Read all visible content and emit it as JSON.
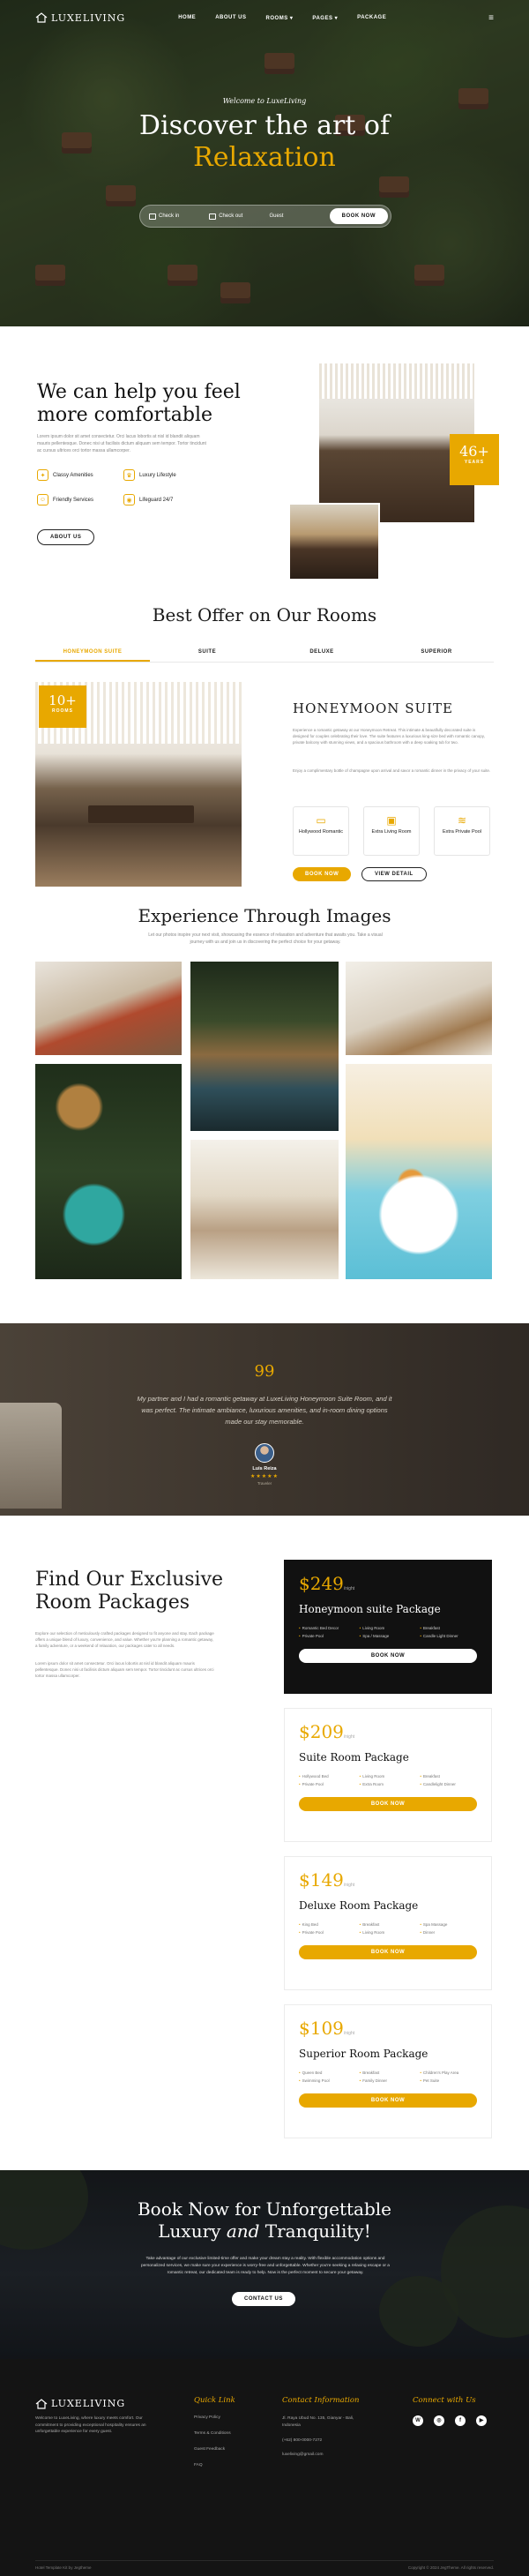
{
  "brand": {
    "name": "LUXELIVING"
  },
  "nav": {
    "items": [
      "HOME",
      "ABOUT US",
      "ROOMS",
      "PAGES",
      "PACKAGE"
    ]
  },
  "hero": {
    "subtitle": "Welcome to LuxeLiving",
    "title_line1": "Discover the art of",
    "title_line2": "Relaxation",
    "checkin": "Check in",
    "checkout": "Check out",
    "guest": "Guest",
    "book_button": "BOOK NOW"
  },
  "about": {
    "title_line1": "We can help you feel",
    "title_line2": "more comfortable",
    "text": "Lorem ipsum dolor sit amet consectetur. Orci lacus lobortis at nisl id blandit aliquam mauris pellentesque. Donec nisi ut facilisis dictum aliquam sem tempor. Tortor tincidunt ac cursus ultrices orci tortor massa ullamcorper.",
    "amenities": [
      "Classy Amenities",
      "Luxury Lifestyle",
      "Friendly Services",
      "Lifeguard 24/7"
    ],
    "button": "ABOUT US",
    "years_number": "46+",
    "years_label": "YEARS"
  },
  "rooms": {
    "title": "Best Offer on Our Rooms",
    "tabs": [
      "HONEYMOON SUITE",
      "SUITE",
      "DELUXE",
      "SUPERIOR"
    ],
    "badge_number": "10+",
    "badge_label": "ROOMS",
    "room_title": "HONEYMOON SUITE",
    "desc1": "Experience a romantic getaway at our Honeymoon Retreat. This intimate & beautifully decorated suite is designed for couples celebrating their love. The suite features a luxurious king-size bed with romantic canopy, private balcony with stunning views, and a spacious bathroom with a deep soaking tub for two.",
    "desc2": "Enjoy a complimentary bottle of champagne upon arrival and savor a romantic dinner in the privacy of your suite.",
    "features": [
      "Hollywood Romantic",
      "Extra Living Room",
      "Extra Private Pool"
    ],
    "book_button": "BOOK NOW",
    "detail_button": "VIEW DETAIL"
  },
  "gallery": {
    "title": "Experience Through Images",
    "text": "Let our photos inspire your next visit, showcasing the essence of relaxation and adventure that awaits you. Take a visual journey with us and join us in discovering the perfect choice for your getaway."
  },
  "testimonial": {
    "quote_mark": "99",
    "text": "My partner and I had a romantic getaway at LuxeLiving Honeymoon Suite Room, and it was perfect. The intimate ambiance, luxurious amenities, and in-room dining options made our stay memorable.",
    "name": "Luis Reiza",
    "stars": "★★★★★",
    "role": "Traveler"
  },
  "packages": {
    "title_line1": "Find Our Exclusive",
    "title_line2": "Room Packages",
    "text1": "Explore our selection of meticulously crafted packages designed to fit anyone and stay. Each package offers a unique blend of luxury, convenience, and value. Whether you're planning a romantic getaway, a family adventure, or a weekend of relaxation, our packages cater to all needs.",
    "text2": "Lorem ipsum dolor sit amet consectetur. Orci lacus lobortis at nisl id blandit aliquam mauris pellentesque. Donec nisi ut facilisis dictum aliquam sem tempor. Tortor tincidunt ac cursus ultrices orci tortor massa ullamcorper.",
    "per_night": "/night",
    "cards": [
      {
        "price": "$249",
        "title": "Honeymoon suite Package",
        "items": [
          "Romantic Bed Decor",
          "Living Room",
          "Breakfast",
          "Private Pool",
          "Spa / Massage",
          "Candle Light Dinner"
        ],
        "button": "BOOK NOW"
      },
      {
        "price": "$209",
        "title": "Suite Room Package",
        "items": [
          "Hollywood Bed",
          "Living Room",
          "Breakfast",
          "Private Pool",
          "Extra Room",
          "Candlelight Dinner"
        ],
        "button": "BOOK NOW"
      },
      {
        "price": "$149",
        "title": "Deluxe Room Package",
        "items": [
          "King Bed",
          "Breakfast",
          "Spa Massage",
          "Private Pool",
          "Living Room",
          "Dinner"
        ],
        "button": "BOOK NOW"
      },
      {
        "price": "$109",
        "title": "Superior Room Package",
        "items": [
          "Queen Bed",
          "Breakfast",
          "Children's Play Area",
          "Swimming Pool",
          "Family Dinner",
          "Pet Suite"
        ],
        "button": "BOOK NOW"
      }
    ]
  },
  "cta": {
    "title_line1": "Book Now for Unforgettable",
    "title_pre": "Luxury ",
    "title_em": "and",
    "title_post": " Tranquility!",
    "text": "Take advantage of our exclusive limited-time offer and make your dream stay a reality. With flexible accommodation options and personalized services, we make sure your experience is worry-free and unforgettable. Whether you're seeking a relaxing escape or a romantic retreat, our dedicated team is ready to help. Now is the perfect moment to secure your getaway.",
    "button": "CONTACT US"
  },
  "footer": {
    "about": "Welcome to LuxeLiving, where luxury meets comfort. Our commitment to providing exceptional hospitality ensures an unforgettable experience for every guest.",
    "quick_title": "Quick Link",
    "quick_links": [
      "Privacy Policy",
      "Terms & Conditions",
      "Guest Feedback",
      "FAQ"
    ],
    "contact_title": "Contact Information",
    "address": "Jl. Raya Ubud No. 135, Gianyar - Bali, Indonesia",
    "phone": "(+62) 800-0000-7272",
    "email": "luxeliving@gmail.com",
    "connect_title": "Connect with Us",
    "socials": [
      "W",
      "◎",
      "f",
      "▶"
    ],
    "credit": "Hotel Template Kit by Jegtheme",
    "copyright": "Copyright © 2024 JegTheme. All rights reserved."
  }
}
